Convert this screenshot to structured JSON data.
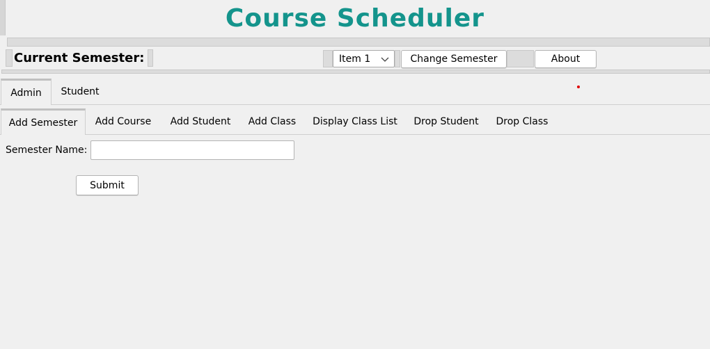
{
  "header": {
    "title": "Course Scheduler",
    "title_color": "#14948c"
  },
  "toolbar": {
    "current_semester_label": "Current Semester:",
    "semester_select_value": "Item 1",
    "change_semester_label": "Change Semester",
    "about_label": "About"
  },
  "tabs": {
    "top": [
      {
        "label": "Admin",
        "selected": true
      },
      {
        "label": "Student",
        "selected": false
      }
    ],
    "sub": [
      {
        "label": "Add Semester",
        "selected": true
      },
      {
        "label": "Add Course",
        "selected": false
      },
      {
        "label": "Add Student",
        "selected": false
      },
      {
        "label": "Add Class",
        "selected": false
      },
      {
        "label": "Display Class List",
        "selected": false
      },
      {
        "label": "Drop Student",
        "selected": false
      },
      {
        "label": "Drop Class",
        "selected": false
      }
    ]
  },
  "form": {
    "semester_name_label": "Semester Name:",
    "semester_name_value": "",
    "submit_label": "Submit"
  },
  "icons": {
    "select_arrow": "chevron-down-icon"
  },
  "colors": {
    "background": "#f0f0f0",
    "indicator_dot": "#e00000"
  }
}
